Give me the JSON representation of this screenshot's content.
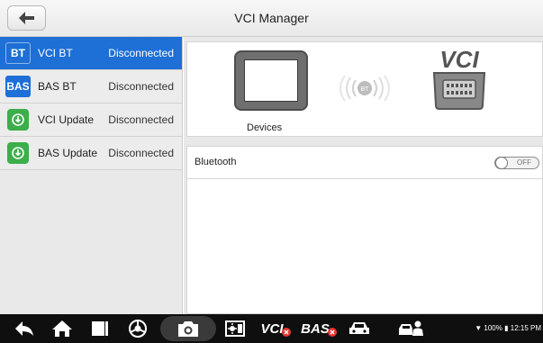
{
  "header": {
    "title": "VCI Manager",
    "back_icon": "back-arrow-icon"
  },
  "sidebar": {
    "items": [
      {
        "icon_text": "BT",
        "label": "VCI BT",
        "status": "Disconnected",
        "active": true
      },
      {
        "icon_text": "BAS",
        "label": "BAS BT",
        "status": "Disconnected",
        "active": false
      },
      {
        "icon_text": "",
        "label": "VCI Update",
        "status": "Disconnected",
        "active": false
      },
      {
        "icon_text": "",
        "label": "BAS Update",
        "status": "Disconnected",
        "active": false
      }
    ]
  },
  "devices": {
    "label": "Devices",
    "signal_badge": "BT",
    "vci_logo_text": "VCI"
  },
  "bluetooth": {
    "label": "Bluetooth",
    "toggle_text": "OFF",
    "enabled": false
  },
  "navbar": {
    "vci_text": "VCI",
    "bas_text": "BAS",
    "battery": "100%",
    "time": "12:15 PM"
  },
  "colors": {
    "accent": "#1e6fd6",
    "update_green": "#3cae4a",
    "navbar_bg": "#0f0f0f",
    "error_red": "#e53935"
  }
}
